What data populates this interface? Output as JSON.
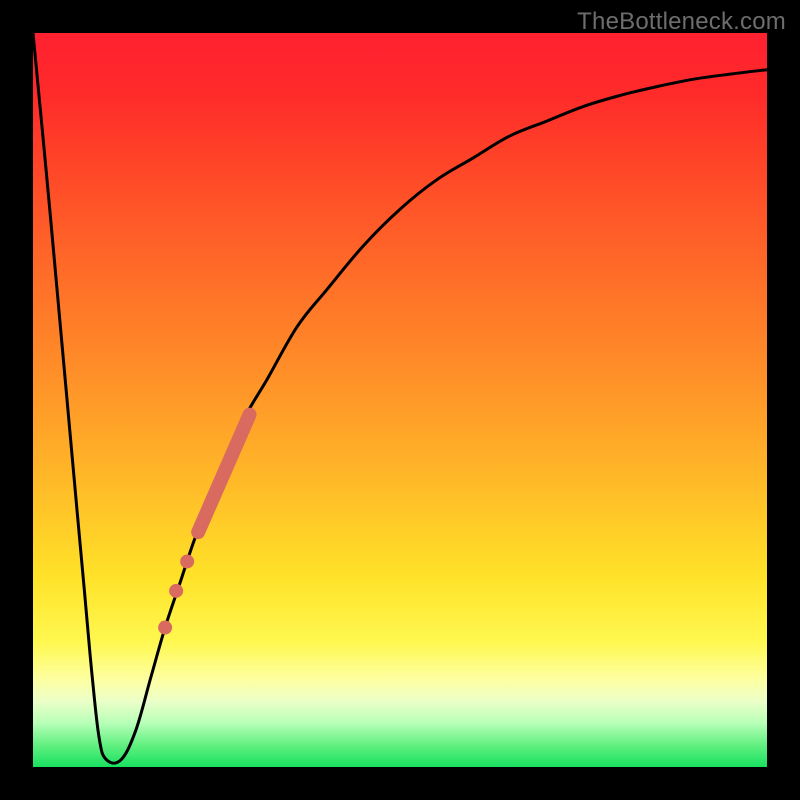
{
  "watermark": "TheBottleneck.com",
  "chart_data": {
    "type": "line",
    "title": "",
    "xlabel": "",
    "ylabel": "",
    "xlim": [
      0,
      100
    ],
    "ylim": [
      0,
      100
    ],
    "background": "rainbow-gradient-red-top-green-bottom",
    "series": [
      {
        "name": "bottleneck-curve",
        "color": "#000000",
        "x": [
          0,
          2,
          4,
          5,
          6,
          7,
          8,
          9,
          10,
          12,
          14,
          16,
          18,
          20,
          22,
          24,
          28,
          32,
          36,
          40,
          45,
          50,
          55,
          60,
          65,
          70,
          75,
          80,
          85,
          90,
          95,
          100
        ],
        "y": [
          100,
          79,
          57,
          46,
          35,
          24,
          13,
          4,
          1,
          1,
          5,
          12,
          19,
          25,
          31,
          36,
          46,
          53,
          60,
          65,
          71,
          76,
          80,
          83,
          86,
          88,
          90,
          91.5,
          92.7,
          93.7,
          94.4,
          95
        ]
      }
    ],
    "overlays": [
      {
        "name": "highlight-segment",
        "type": "line",
        "color": "#d86a5f",
        "stroke_width": 14,
        "linecap": "round",
        "x": [
          22.5,
          29.5
        ],
        "y": [
          32,
          48
        ]
      },
      {
        "name": "highlight-dot-1",
        "type": "scatter",
        "color": "#d86a5f",
        "radius": 7,
        "x": [
          21
        ],
        "y": [
          28
        ]
      },
      {
        "name": "highlight-dot-2",
        "type": "scatter",
        "color": "#d86a5f",
        "radius": 7,
        "x": [
          19.5
        ],
        "y": [
          24
        ]
      },
      {
        "name": "highlight-dot-3",
        "type": "scatter",
        "color": "#d86a5f",
        "radius": 7,
        "x": [
          18
        ],
        "y": [
          19
        ]
      }
    ]
  }
}
